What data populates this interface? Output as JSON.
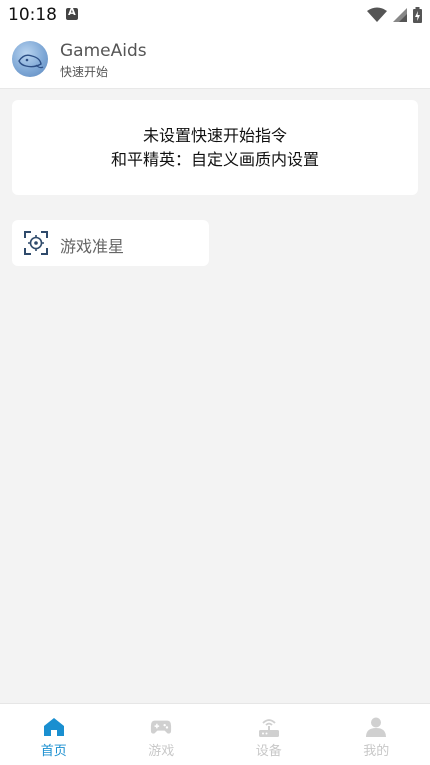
{
  "status_bar": {
    "time": "10:18"
  },
  "header": {
    "app_title": "GameAids",
    "app_subtitle": "快速开始"
  },
  "quick_start_card": {
    "line1": "未设置快速开始指令",
    "line2": "和平精英：自定义画质内设置"
  },
  "crosshair_card": {
    "label": "游戏准星",
    "icon": "crosshair-icon"
  },
  "bottom_nav": {
    "active_color": "#1a8fd0",
    "inactive_color": "#c8c8c8",
    "items": [
      {
        "label": "首页",
        "icon": "home-icon",
        "active": true
      },
      {
        "label": "游戏",
        "icon": "gamepad-icon",
        "active": false
      },
      {
        "label": "设备",
        "icon": "router-icon",
        "active": false
      },
      {
        "label": "我的",
        "icon": "person-icon",
        "active": false
      }
    ]
  }
}
